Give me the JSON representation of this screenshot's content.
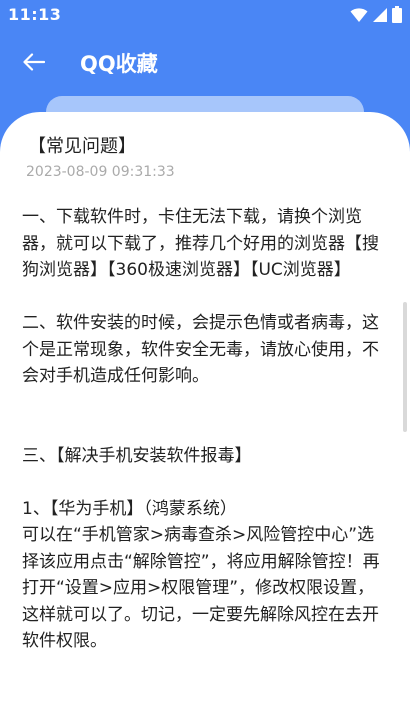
{
  "status_bar": {
    "time": "11:13",
    "icons": [
      "wifi-icon",
      "signal-icon",
      "battery-icon"
    ]
  },
  "app_bar": {
    "title": "QQ收藏",
    "back_icon": "arrow-left-icon"
  },
  "post": {
    "title": "【常见问题】",
    "timestamp": "2023-08-09 09:31:33",
    "body": "一、下载软件时，卡住无法下载，请换个浏览器，就可以下载了，推荐几个好用的浏览器【搜狗浏览器】【360极速浏览器】【UC浏览器】\n\n二、软件安装的时候，会提示色情或者病毒，这个是正常现象，软件安全无毒，请放心使用，不会对手机造成任何影响。\n\n\n三、【解决手机安装软件报毒】\n\n1、【华为手机】（鸿蒙系统）\n可以在“手机管家>病毒查杀>风险管控中心”选择该应用点击“解除管控”，将应用解除管控！再打开“设置>应用>权限管理”，修改权限设置，这样就可以了。切记，一定要先解除风控在去开软件权限。"
  },
  "colors": {
    "header_bg": "#4a86f5",
    "card_bg": "#ffffff",
    "text": "#222222",
    "timestamp": "#aaaaaa"
  }
}
